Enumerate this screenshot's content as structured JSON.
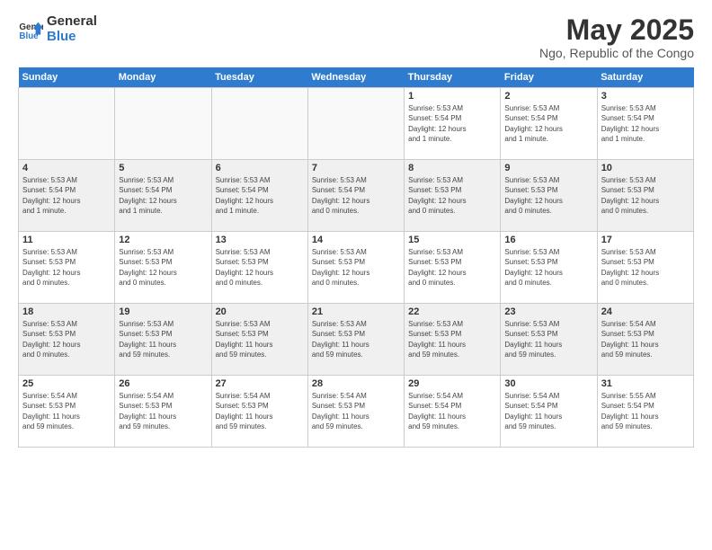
{
  "logo": {
    "line1": "General",
    "line2": "Blue"
  },
  "title": "May 2025",
  "subtitle": "Ngo, Republic of the Congo",
  "days_of_week": [
    "Sunday",
    "Monday",
    "Tuesday",
    "Wednesday",
    "Thursday",
    "Friday",
    "Saturday"
  ],
  "weeks": [
    [
      {
        "num": "",
        "info": "",
        "empty": true
      },
      {
        "num": "",
        "info": "",
        "empty": true
      },
      {
        "num": "",
        "info": "",
        "empty": true
      },
      {
        "num": "",
        "info": "",
        "empty": true
      },
      {
        "num": "1",
        "info": "Sunrise: 5:53 AM\nSunset: 5:54 PM\nDaylight: 12 hours\nand 1 minute."
      },
      {
        "num": "2",
        "info": "Sunrise: 5:53 AM\nSunset: 5:54 PM\nDaylight: 12 hours\nand 1 minute."
      },
      {
        "num": "3",
        "info": "Sunrise: 5:53 AM\nSunset: 5:54 PM\nDaylight: 12 hours\nand 1 minute."
      }
    ],
    [
      {
        "num": "4",
        "info": "Sunrise: 5:53 AM\nSunset: 5:54 PM\nDaylight: 12 hours\nand 1 minute."
      },
      {
        "num": "5",
        "info": "Sunrise: 5:53 AM\nSunset: 5:54 PM\nDaylight: 12 hours\nand 1 minute."
      },
      {
        "num": "6",
        "info": "Sunrise: 5:53 AM\nSunset: 5:54 PM\nDaylight: 12 hours\nand 1 minute."
      },
      {
        "num": "7",
        "info": "Sunrise: 5:53 AM\nSunset: 5:54 PM\nDaylight: 12 hours\nand 0 minutes."
      },
      {
        "num": "8",
        "info": "Sunrise: 5:53 AM\nSunset: 5:53 PM\nDaylight: 12 hours\nand 0 minutes."
      },
      {
        "num": "9",
        "info": "Sunrise: 5:53 AM\nSunset: 5:53 PM\nDaylight: 12 hours\nand 0 minutes."
      },
      {
        "num": "10",
        "info": "Sunrise: 5:53 AM\nSunset: 5:53 PM\nDaylight: 12 hours\nand 0 minutes."
      }
    ],
    [
      {
        "num": "11",
        "info": "Sunrise: 5:53 AM\nSunset: 5:53 PM\nDaylight: 12 hours\nand 0 minutes."
      },
      {
        "num": "12",
        "info": "Sunrise: 5:53 AM\nSunset: 5:53 PM\nDaylight: 12 hours\nand 0 minutes."
      },
      {
        "num": "13",
        "info": "Sunrise: 5:53 AM\nSunset: 5:53 PM\nDaylight: 12 hours\nand 0 minutes."
      },
      {
        "num": "14",
        "info": "Sunrise: 5:53 AM\nSunset: 5:53 PM\nDaylight: 12 hours\nand 0 minutes."
      },
      {
        "num": "15",
        "info": "Sunrise: 5:53 AM\nSunset: 5:53 PM\nDaylight: 12 hours\nand 0 minutes."
      },
      {
        "num": "16",
        "info": "Sunrise: 5:53 AM\nSunset: 5:53 PM\nDaylight: 12 hours\nand 0 minutes."
      },
      {
        "num": "17",
        "info": "Sunrise: 5:53 AM\nSunset: 5:53 PM\nDaylight: 12 hours\nand 0 minutes."
      }
    ],
    [
      {
        "num": "18",
        "info": "Sunrise: 5:53 AM\nSunset: 5:53 PM\nDaylight: 12 hours\nand 0 minutes."
      },
      {
        "num": "19",
        "info": "Sunrise: 5:53 AM\nSunset: 5:53 PM\nDaylight: 11 hours\nand 59 minutes."
      },
      {
        "num": "20",
        "info": "Sunrise: 5:53 AM\nSunset: 5:53 PM\nDaylight: 11 hours\nand 59 minutes."
      },
      {
        "num": "21",
        "info": "Sunrise: 5:53 AM\nSunset: 5:53 PM\nDaylight: 11 hours\nand 59 minutes."
      },
      {
        "num": "22",
        "info": "Sunrise: 5:53 AM\nSunset: 5:53 PM\nDaylight: 11 hours\nand 59 minutes."
      },
      {
        "num": "23",
        "info": "Sunrise: 5:53 AM\nSunset: 5:53 PM\nDaylight: 11 hours\nand 59 minutes."
      },
      {
        "num": "24",
        "info": "Sunrise: 5:54 AM\nSunset: 5:53 PM\nDaylight: 11 hours\nand 59 minutes."
      }
    ],
    [
      {
        "num": "25",
        "info": "Sunrise: 5:54 AM\nSunset: 5:53 PM\nDaylight: 11 hours\nand 59 minutes."
      },
      {
        "num": "26",
        "info": "Sunrise: 5:54 AM\nSunset: 5:53 PM\nDaylight: 11 hours\nand 59 minutes."
      },
      {
        "num": "27",
        "info": "Sunrise: 5:54 AM\nSunset: 5:53 PM\nDaylight: 11 hours\nand 59 minutes."
      },
      {
        "num": "28",
        "info": "Sunrise: 5:54 AM\nSunset: 5:53 PM\nDaylight: 11 hours\nand 59 minutes."
      },
      {
        "num": "29",
        "info": "Sunrise: 5:54 AM\nSunset: 5:54 PM\nDaylight: 11 hours\nand 59 minutes."
      },
      {
        "num": "30",
        "info": "Sunrise: 5:54 AM\nSunset: 5:54 PM\nDaylight: 11 hours\nand 59 minutes."
      },
      {
        "num": "31",
        "info": "Sunrise: 5:55 AM\nSunset: 5:54 PM\nDaylight: 11 hours\nand 59 minutes."
      }
    ]
  ]
}
